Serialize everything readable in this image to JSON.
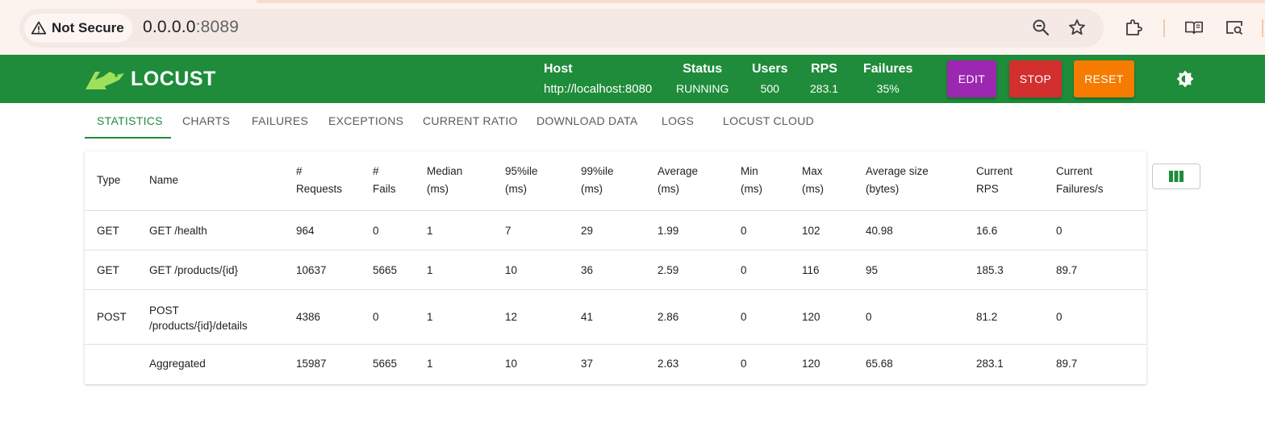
{
  "browser": {
    "security_label": "Not Secure",
    "url_host": "0.0.0.0",
    "url_port": ":8089"
  },
  "header": {
    "logo_text": "LOCUST",
    "host_label": "Host",
    "host_value": "http://localhost:8080",
    "status_label": "Status",
    "status_value": "RUNNING",
    "users_label": "Users",
    "users_value": "500",
    "rps_label": "RPS",
    "rps_value": "283.1",
    "failures_label": "Failures",
    "failures_value": "35%",
    "edit_label": "EDIT",
    "stop_label": "STOP",
    "reset_label": "RESET",
    "colors": {
      "header_bg": "#1e8c3a",
      "edit": "#9c27b0",
      "stop": "#d32f2f",
      "reset": "#f57c00"
    }
  },
  "tabs": [
    {
      "label": "STATISTICS",
      "active": true
    },
    {
      "label": "CHARTS"
    },
    {
      "label": "FAILURES"
    },
    {
      "label": "EXCEPTIONS"
    },
    {
      "label": "CURRENT RATIO"
    },
    {
      "label": "DOWNLOAD DATA"
    },
    {
      "label": "LOGS"
    },
    {
      "label": "LOCUST CLOUD"
    }
  ],
  "table": {
    "headers": [
      [
        "Type",
        ""
      ],
      [
        "Name",
        ""
      ],
      [
        "#",
        "Requests"
      ],
      [
        "#",
        "Fails"
      ],
      [
        "Median",
        "(ms)"
      ],
      [
        "95%ile",
        "(ms)"
      ],
      [
        "99%ile",
        "(ms)"
      ],
      [
        "Average",
        "(ms)"
      ],
      [
        "Min",
        "(ms)"
      ],
      [
        "Max",
        "(ms)"
      ],
      [
        "Average size",
        "(bytes)"
      ],
      [
        "Current",
        "RPS"
      ],
      [
        "Current",
        "Failures/s"
      ]
    ],
    "rows": [
      {
        "type": "GET",
        "name": [
          "GET /health"
        ],
        "requests": "964",
        "fails": "0",
        "median": "1",
        "p95": "7",
        "p99": "29",
        "avg": "1.99",
        "min": "0",
        "max": "102",
        "avg_size": "40.98",
        "rps": "16.6",
        "fps": "0"
      },
      {
        "type": "GET",
        "name": [
          "GET /products/{id}"
        ],
        "requests": "10637",
        "fails": "5665",
        "median": "1",
        "p95": "10",
        "p99": "36",
        "avg": "2.59",
        "min": "0",
        "max": "116",
        "avg_size": "95",
        "rps": "185.3",
        "fps": "89.7"
      },
      {
        "type": "POST",
        "name": [
          "POST",
          "/products/{id}/details"
        ],
        "requests": "4386",
        "fails": "0",
        "median": "1",
        "p95": "12",
        "p99": "41",
        "avg": "2.86",
        "min": "0",
        "max": "120",
        "avg_size": "0",
        "rps": "81.2",
        "fps": "0"
      },
      {
        "type": "",
        "name": [
          "Aggregated"
        ],
        "requests": "15987",
        "fails": "5665",
        "median": "1",
        "p95": "10",
        "p99": "37",
        "avg": "2.63",
        "min": "0",
        "max": "120",
        "avg_size": "65.68",
        "rps": "283.1",
        "fps": "89.7"
      }
    ]
  },
  "icons": {
    "warning": "warning-triangle-icon",
    "zoom": "zoom-out-icon",
    "star": "star-icon",
    "extensions": "puzzle-icon",
    "reading": "reading-mode-icon",
    "screen_search": "screen-search-icon",
    "theme": "brightness-icon",
    "columns": "view-columns-icon"
  }
}
